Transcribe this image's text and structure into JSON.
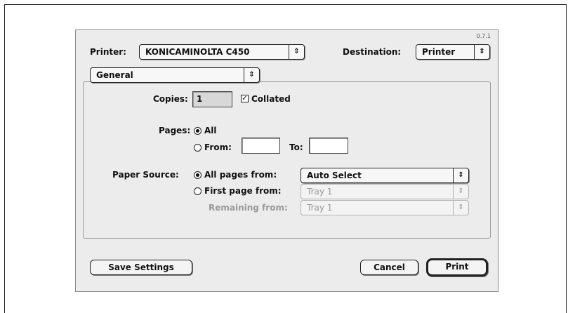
{
  "version": "0.7.1",
  "printer": {
    "label": "Printer:",
    "value": "KONICAMINOLTA C450"
  },
  "destination": {
    "label": "Destination:",
    "value": "Printer"
  },
  "panel": {
    "value": "General"
  },
  "copies": {
    "label": "Copies:",
    "value": "1",
    "collated_label": "Collated",
    "collated_checked": true
  },
  "pages": {
    "label": "Pages:",
    "all_label": "All",
    "from_label": "From:",
    "to_label": "To:",
    "from_value": "",
    "to_value": ""
  },
  "paper_source": {
    "label": "Paper Source:",
    "all_pages_label": "All pages from:",
    "all_pages_value": "Auto Select",
    "first_page_label": "First page from:",
    "first_page_value": "Tray 1",
    "remaining_label": "Remaining from:",
    "remaining_value": "Tray 1"
  },
  "buttons": {
    "save_settings": "Save Settings",
    "cancel": "Cancel",
    "print": "Print"
  },
  "icons": {
    "popup_arrows": "⇕",
    "check": "✓"
  }
}
